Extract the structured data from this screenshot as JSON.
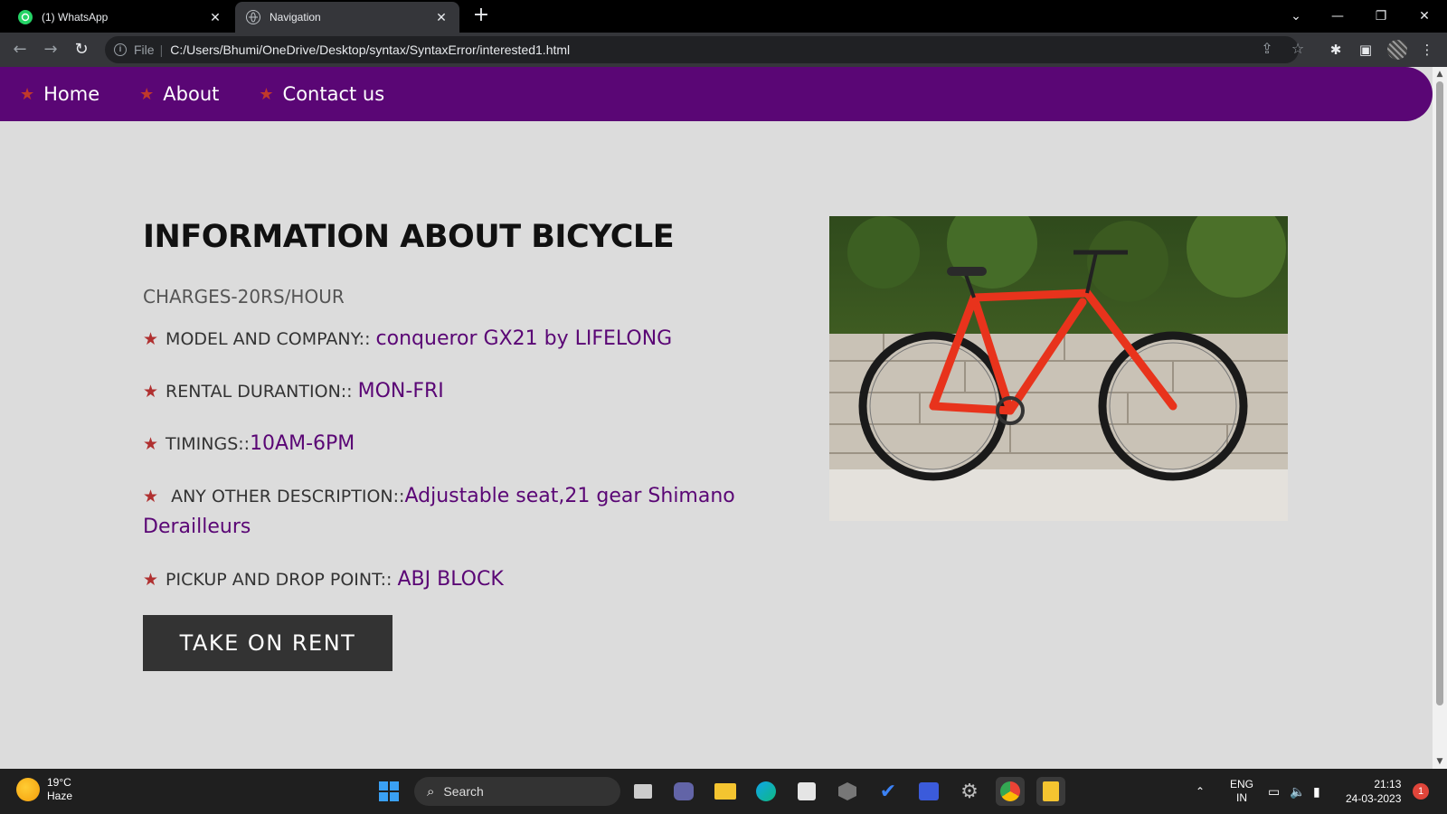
{
  "browser": {
    "tabs": [
      {
        "title": "(1) WhatsApp",
        "icon": "whatsapp-icon",
        "active": false
      },
      {
        "title": "Navigation",
        "icon": "globe-icon",
        "active": true
      }
    ],
    "address": {
      "scheme": "File",
      "url": "C:/Users/Bhumi/OneDrive/Desktop/syntax/SyntaxError/interested1.html"
    }
  },
  "site": {
    "nav": [
      {
        "label": "Home"
      },
      {
        "label": "About"
      },
      {
        "label": "Contact us"
      }
    ],
    "heading": "INFORMATION ABOUT BICYCLE",
    "charges": "CHARGES-20RS/HOUR",
    "details": [
      {
        "label": "MODEL AND COMPANY:: ",
        "value": "conqueror GX21 by LIFELONG"
      },
      {
        "label": "RENTAL DURANTION:: ",
        "value": "MON-FRI"
      },
      {
        "label": "TIMINGS::",
        "value": "10AM-6PM"
      },
      {
        "label": " ANY OTHER DESCRIPTION::",
        "value": "Adjustable seat,21 gear Shimano Derailleurs"
      },
      {
        "label": "PICKUP AND DROP POINT:: ",
        "value": "ABJ BLOCK"
      }
    ],
    "button_label": "TAKE ON RENT",
    "colors": {
      "nav_bg": "#5a0675",
      "accent_value": "#5a0675",
      "star": "#b03030",
      "button_bg": "#333333"
    }
  },
  "taskbar": {
    "weather": {
      "temp": "19°C",
      "condition": "Haze"
    },
    "search_placeholder": "Search",
    "language": {
      "line1": "ENG",
      "line2": "IN"
    },
    "clock": {
      "time": "21:13",
      "date": "24-03-2023"
    },
    "notification_count": "1"
  }
}
